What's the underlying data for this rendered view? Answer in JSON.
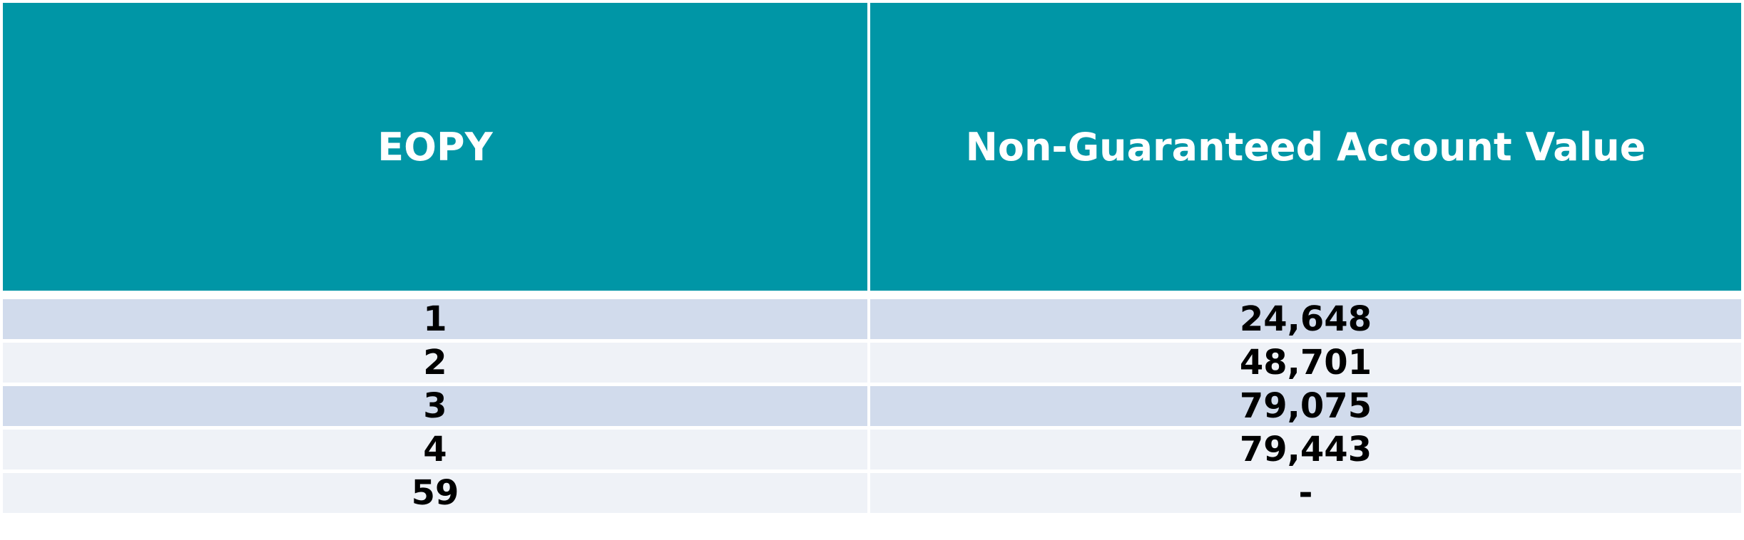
{
  "table": {
    "headers": [
      "EOPY",
      "Non-Guaranteed Account Value"
    ],
    "rows": [
      [
        "1",
        "24,648"
      ],
      [
        "2",
        "48,701"
      ],
      [
        "3",
        "79,075"
      ],
      [
        "4",
        "79,443"
      ],
      [
        "59",
        "-"
      ]
    ]
  },
  "colors": {
    "header_bg": "#0096a6",
    "header_text": "#ffffff",
    "row_band_1": "#d1dbec",
    "row_band_2": "#eff2f7",
    "cell_text": "#000000"
  }
}
